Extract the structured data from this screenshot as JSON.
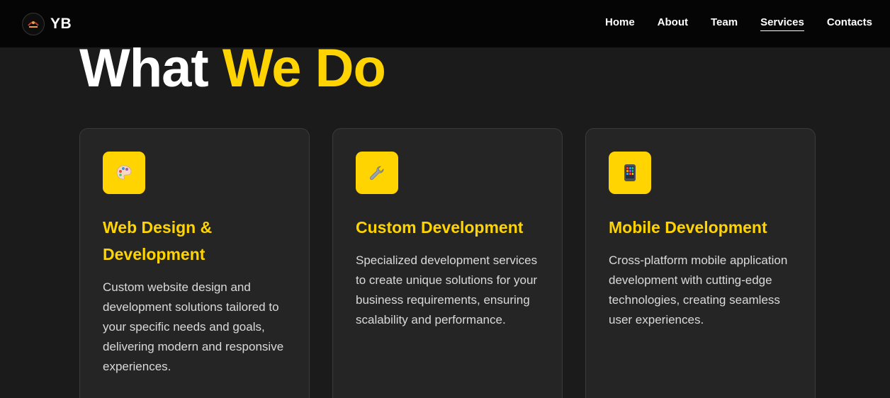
{
  "nav": {
    "brand": "YB",
    "links": [
      {
        "label": "Home",
        "active": false
      },
      {
        "label": "About",
        "active": false
      },
      {
        "label": "Team",
        "active": false
      },
      {
        "label": "Services",
        "active": true
      },
      {
        "label": "Contacts",
        "active": false
      }
    ]
  },
  "heading": {
    "part1": "What",
    "part2": "We Do"
  },
  "services": [
    {
      "icon": "palette-icon",
      "title": "Web Design & Development",
      "description": "Custom website design and development solutions tailored to your specific needs and goals, delivering modern and responsive experiences."
    },
    {
      "icon": "wrench-icon",
      "title": "Custom Development",
      "description": "Specialized development services to create unique solutions for your business requirements, ensuring scalability and performance."
    },
    {
      "icon": "mobile-phone-icon",
      "title": "Mobile Development",
      "description": "Cross-platform mobile application development with cutting-edge technologies, creating seamless user experiences."
    }
  ],
  "colors": {
    "accent": "#ffd400",
    "background": "#1b1b1b",
    "card": "#252525",
    "navbar": "#050505"
  }
}
